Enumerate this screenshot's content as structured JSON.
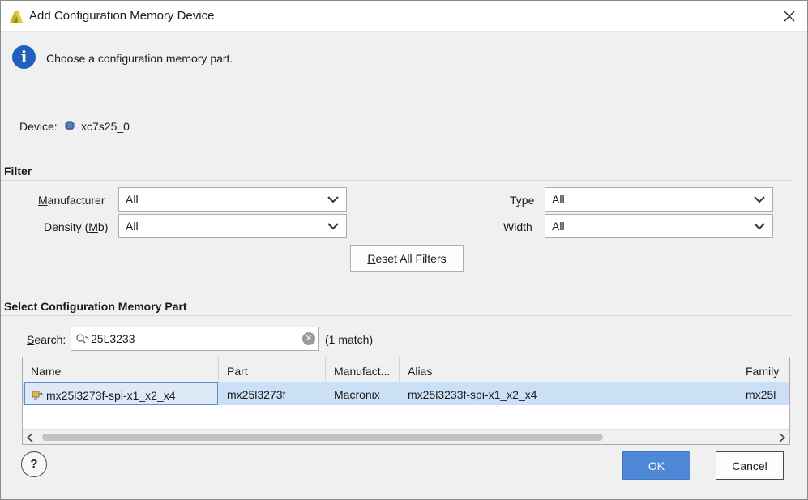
{
  "window": {
    "title": "Add Configuration Memory Device"
  },
  "info": {
    "message": "Choose a configuration memory part."
  },
  "device": {
    "label": "Device:",
    "value": "xc7s25_0"
  },
  "filter": {
    "section_title": "Filter",
    "manufacturer": {
      "label_ul": "M",
      "label_rest": "anufacturer",
      "value": "All"
    },
    "density": {
      "label_pre": "Density (",
      "label_ul": "M",
      "label_post": "b)",
      "value": "All"
    },
    "type": {
      "label": "Type",
      "value": "All"
    },
    "width": {
      "label": "Width",
      "value": "All"
    },
    "reset_ul": "R",
    "reset_rest": "eset All Filters"
  },
  "select": {
    "section_title": "Select Configuration Memory Part",
    "search_label_ul": "S",
    "search_label_rest": "earch:",
    "search_value": "25L3233",
    "match_count": "(1 match)"
  },
  "table": {
    "columns": [
      "Name",
      "Part",
      "Manufact...",
      "Alias",
      "Family"
    ],
    "rows": [
      {
        "name": "mx25l3273f-spi-x1_x2_x4",
        "part": "mx25l3273f",
        "manufacturer": "Macronix",
        "alias": "mx25l3233f-spi-x1_x2_x4",
        "family": "mx25l"
      }
    ]
  },
  "buttons": {
    "help": "?",
    "ok": "OK",
    "cancel": "Cancel"
  },
  "colors": {
    "ok_button": "#4f88d6",
    "selected_row": "#cce0f5",
    "info_icon": "#1f5fbf"
  }
}
